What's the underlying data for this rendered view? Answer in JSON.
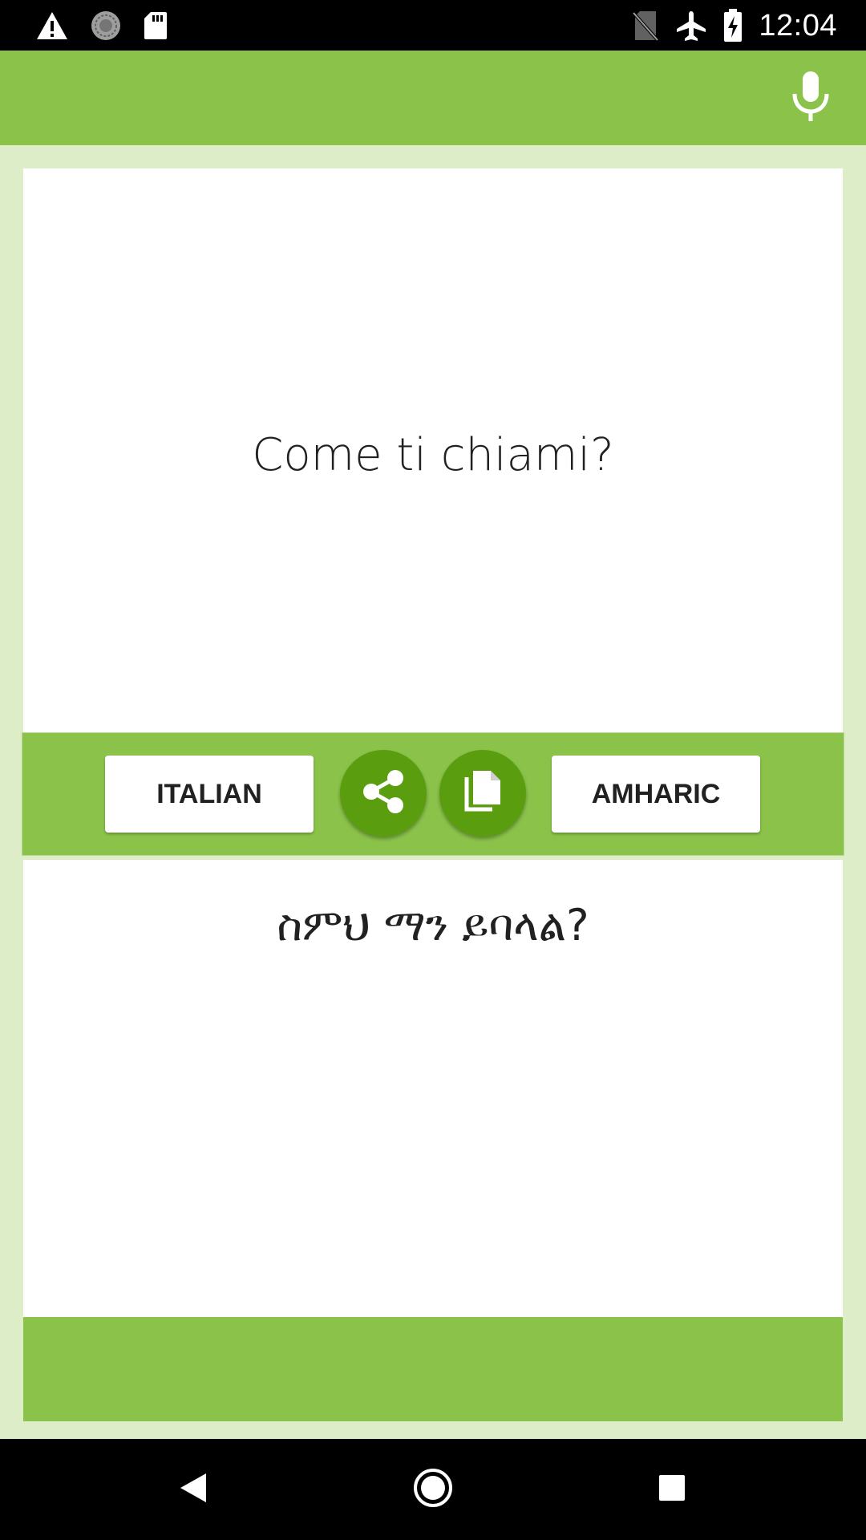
{
  "status_bar": {
    "time": "12:04",
    "left_icons": [
      "warning-icon",
      "sync-icon",
      "sd-card-icon"
    ],
    "right_icons": [
      "no-sim-icon",
      "airplane-mode-icon",
      "battery-charging-icon"
    ]
  },
  "app_bar": {
    "mic_icon": "mic-icon"
  },
  "source": {
    "text": "Come ti chiami?"
  },
  "toolbar": {
    "source_language": "ITALIAN",
    "target_language": "AMHARIC",
    "share_icon": "share-icon",
    "copy_icon": "copy-icon"
  },
  "target": {
    "text": "ስምህ ማን ይባላል?"
  },
  "nav_bar": {
    "buttons": [
      "back-icon",
      "home-icon",
      "recents-icon"
    ]
  },
  "colors": {
    "primary": "#8bc34a",
    "primary_light": "#dcedc8",
    "fab": "#5a9e0f",
    "text": "#212121"
  }
}
